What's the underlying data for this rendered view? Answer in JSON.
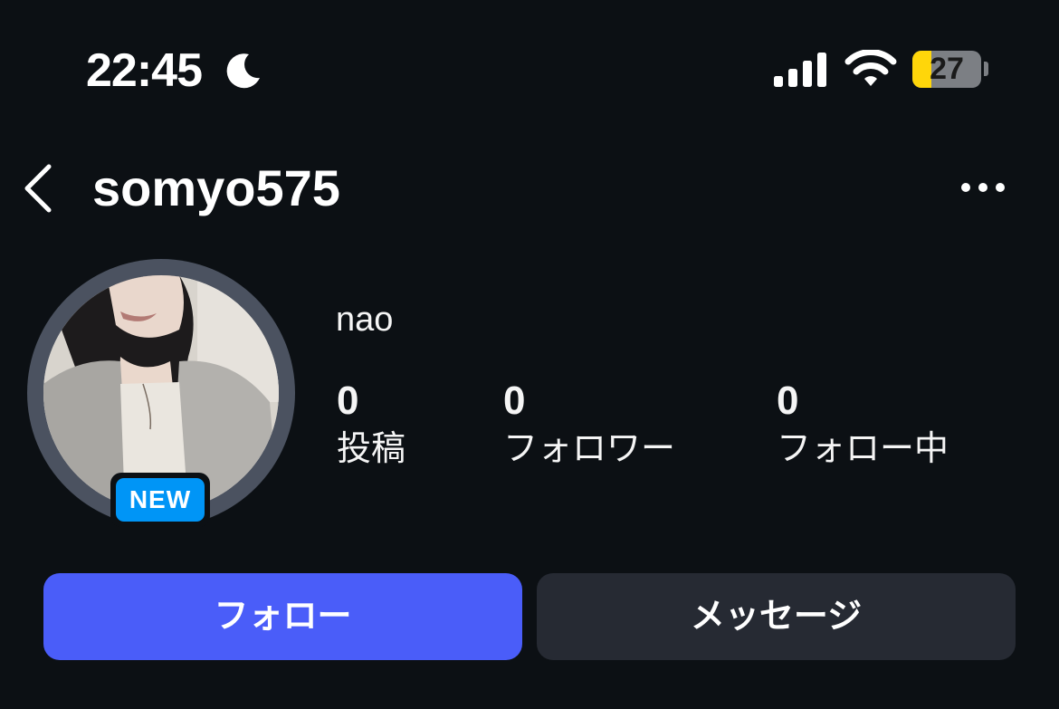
{
  "status_bar": {
    "time": "22:45",
    "focus_icon": "moon-icon",
    "signal_icon": "cellular-signal-icon",
    "wifi_icon": "wifi-icon",
    "battery_level": "27",
    "battery_fill_percent": 27,
    "battery_color": "#ffd60a"
  },
  "header": {
    "back_icon": "chevron-left-icon",
    "username": "somyo575",
    "more_icon": "ellipsis-icon"
  },
  "profile": {
    "display_name": "nao",
    "new_badge": "NEW",
    "stats": {
      "posts": {
        "value": "0",
        "label": "投稿"
      },
      "followers": {
        "value": "0",
        "label": "フォロワー"
      },
      "following": {
        "value": "0",
        "label": "フォロー中"
      }
    }
  },
  "actions": {
    "follow_label": "フォロー",
    "message_label": "メッセージ"
  },
  "colors": {
    "background": "#0c1014",
    "follow_button": "#4a5df9",
    "message_button": "#262a33",
    "new_badge": "#0095f6"
  }
}
